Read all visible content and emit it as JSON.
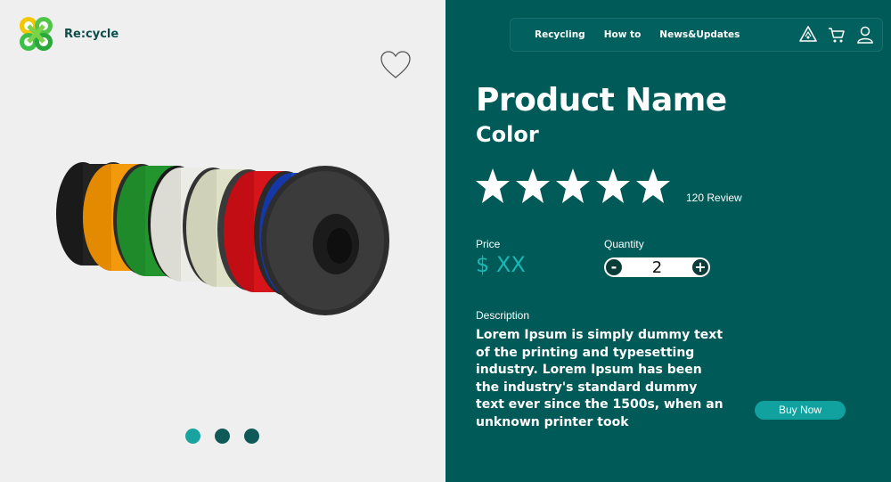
{
  "brand": {
    "name": "Re:cycle",
    "logo_icon": "recycle-logo-icon"
  },
  "nav": {
    "links": [
      "Recycling",
      "How to",
      "News&Updates"
    ],
    "icons": [
      "recycle-bin-icon",
      "cart-icon",
      "user-icon"
    ]
  },
  "product": {
    "name": "Product Name",
    "color": "Color",
    "rating": 5,
    "review_text": "120 Review",
    "price_label": "Price",
    "price": "$ XX",
    "quantity_label": "Quantity",
    "quantity": "2",
    "qty_minus": "-",
    "qty_plus": "+",
    "description_label": "Description",
    "description": "Lorem Ipsum is simply dummy text of the printing and typesetting industry. Lorem Ipsum has been the industry's standard dummy text ever since the 1500s, when an unknown printer took",
    "buy_label": "Buy Now"
  },
  "carousel": {
    "count": 3,
    "active": 0
  },
  "colors": {
    "panel": "#005a58",
    "accent": "#19b7b3",
    "button": "#11a19e",
    "background": "#efefef"
  }
}
